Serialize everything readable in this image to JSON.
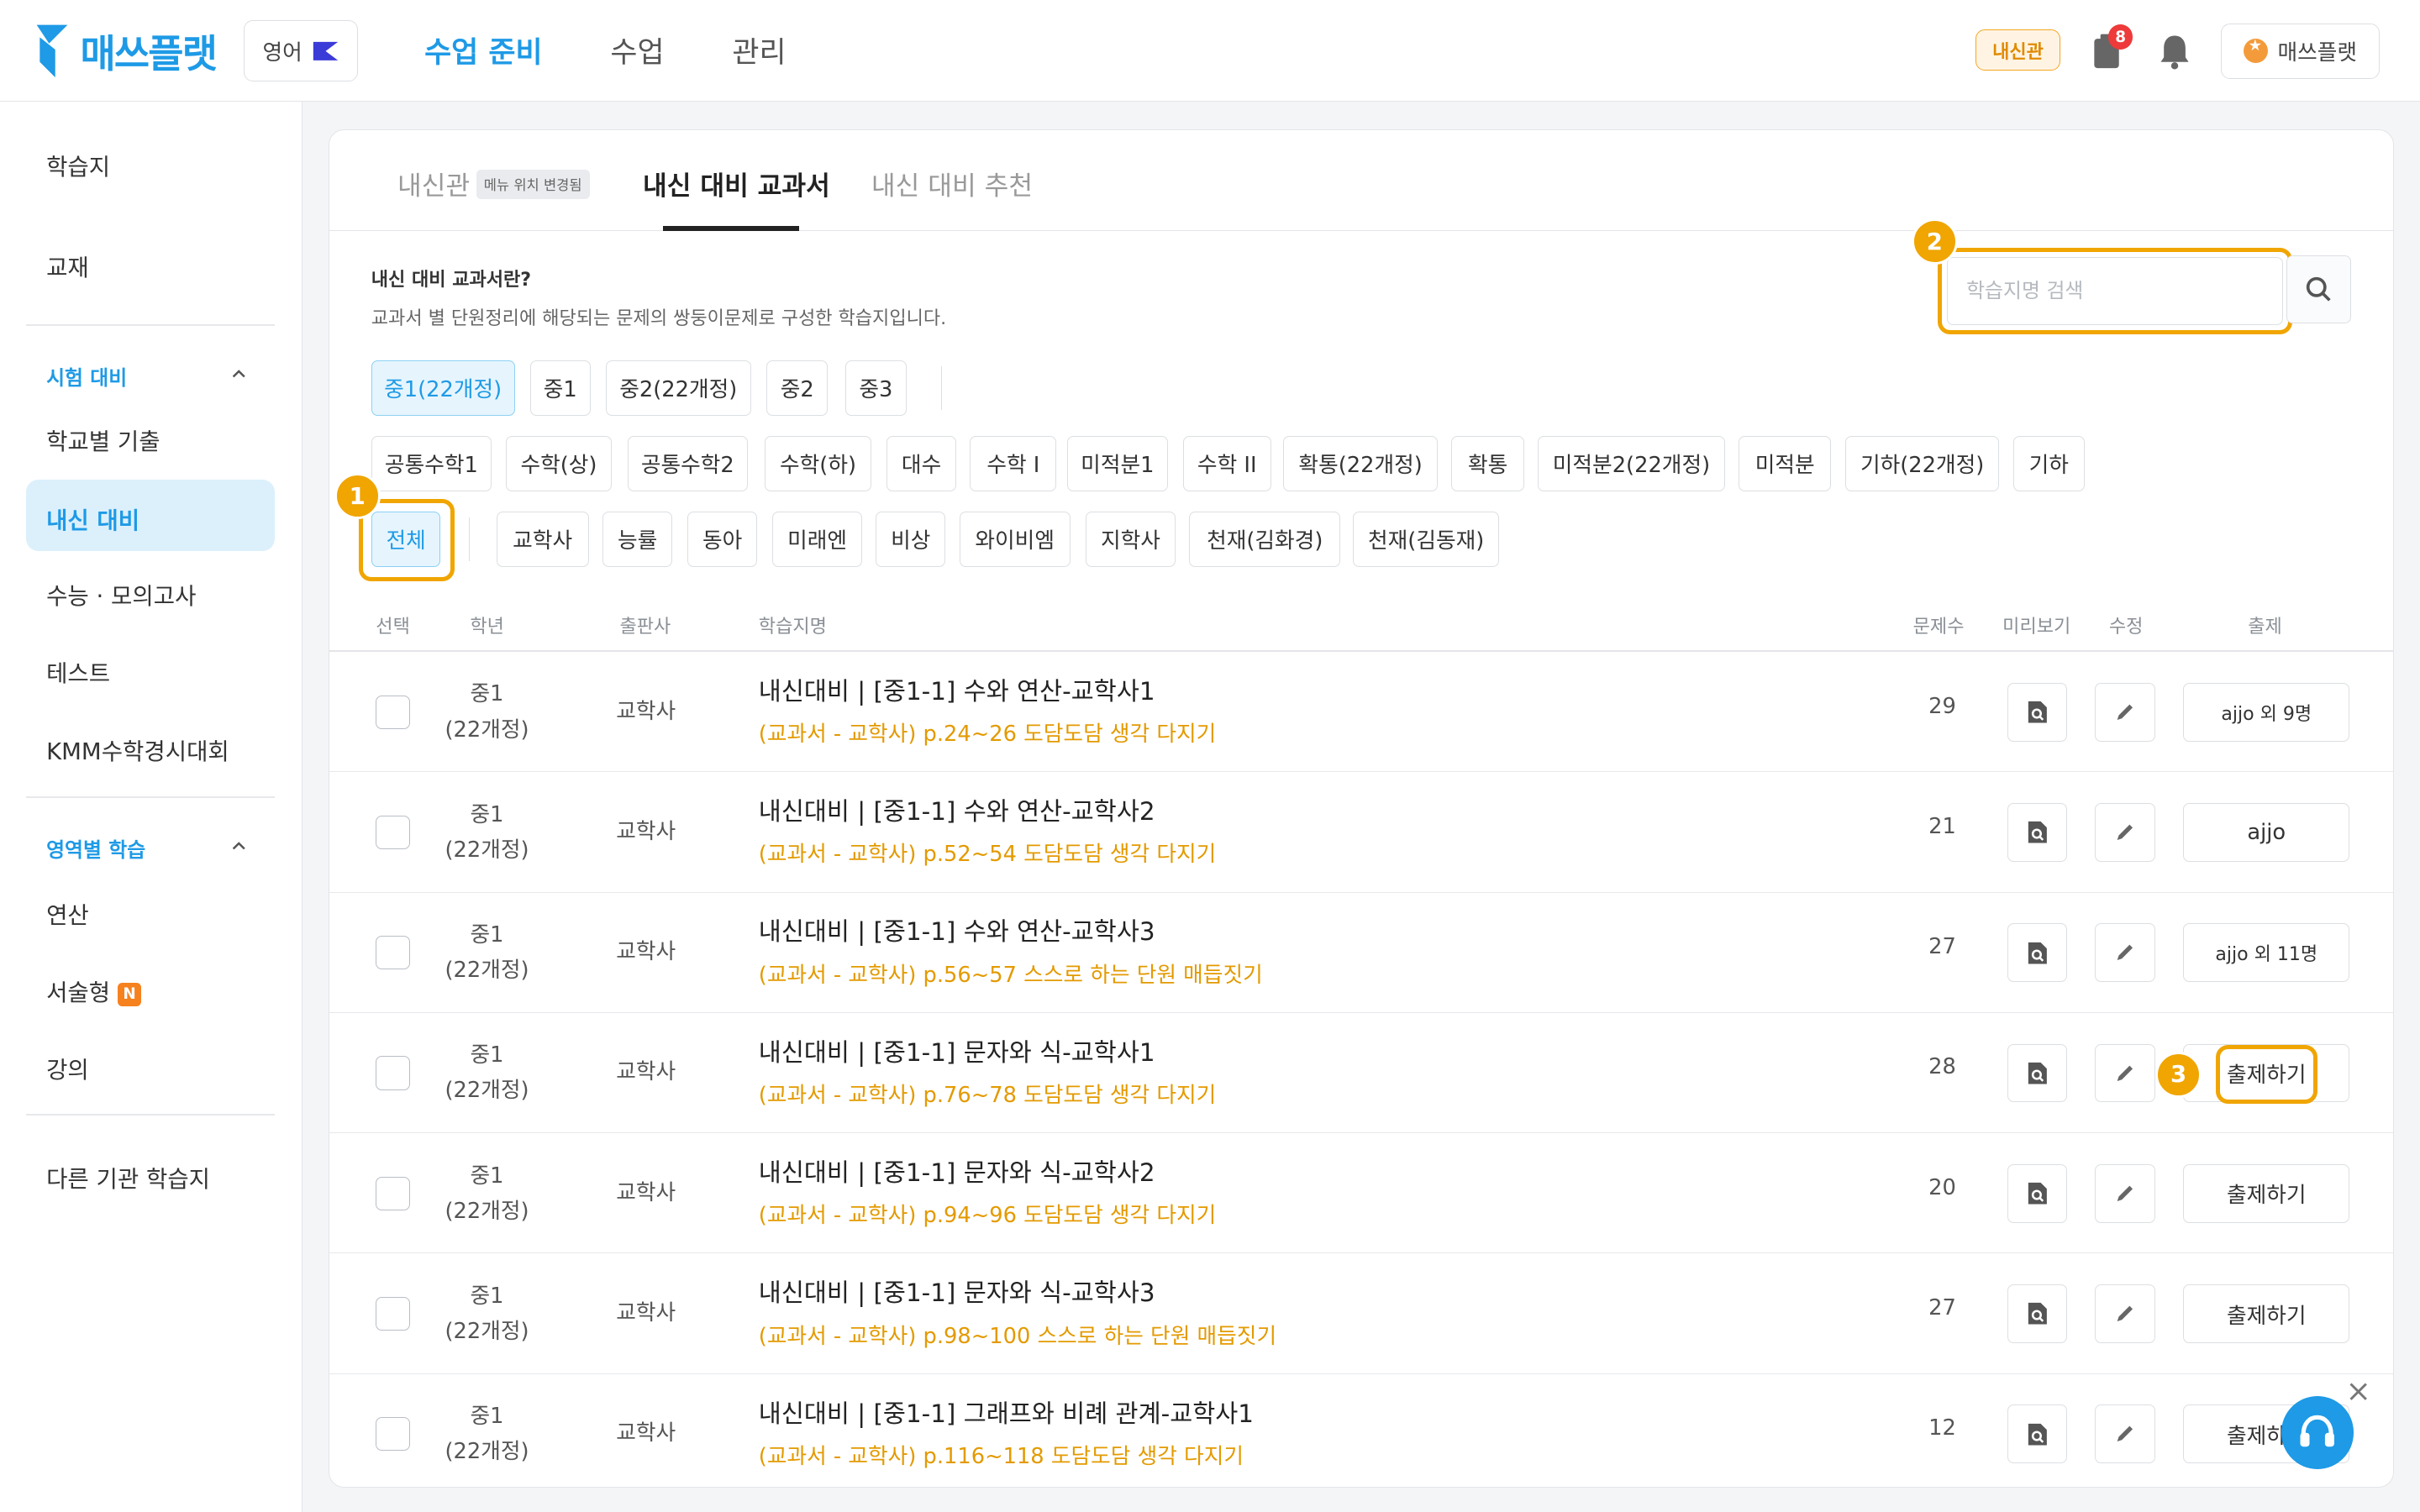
{
  "header": {
    "brand": "매쓰플랫",
    "language": "영어",
    "nav": [
      {
        "label": "수업 준비",
        "active": true
      },
      {
        "label": "수업",
        "active": false
      },
      {
        "label": "관리",
        "active": false
      }
    ],
    "naesin_badge": "내신관",
    "notification_count": "8",
    "user_label": "매쓰플랫"
  },
  "sidebar": {
    "items_top": [
      "학습지",
      "교재"
    ],
    "section_exam": "시험 대비",
    "exam_items": [
      "학교별 기출",
      "내신 대비",
      "수능 · 모의고사",
      "테스트",
      "KMM수학경시대회"
    ],
    "section_area": "영역별 학습",
    "area_items": [
      "연산",
      "서술형",
      "강의"
    ],
    "new_badge": "N",
    "other": "다른 기관 학습지"
  },
  "tabs": [
    {
      "label": "내신관",
      "badge": "메뉴 위치 변경됨",
      "active": false
    },
    {
      "label": "내신 대비 교과서",
      "active": true
    },
    {
      "label": "내신 대비 추천",
      "active": false
    }
  ],
  "description": {
    "title": "내신 대비 교과서란?",
    "text": "교과서 별 단원정리에 해당되는 문제의 쌍둥이문제로 구성한 학습지입니다."
  },
  "search": {
    "placeholder": "학습지명 검색",
    "value": ""
  },
  "callouts": [
    "1",
    "2",
    "3"
  ],
  "filters": {
    "grade": [
      "중1(22개정)",
      "중1",
      "중2(22개정)",
      "중2",
      "중3"
    ],
    "subject": [
      "공통수학1",
      "수학(상)",
      "공통수학2",
      "수학(하)",
      "대수",
      "수학 I",
      "미적분1",
      "수학 II",
      "확통(22개정)",
      "확통",
      "미적분2(22개정)",
      "미적분",
      "기하(22개정)",
      "기하"
    ],
    "publisher_all": "전체",
    "publisher": [
      "교학사",
      "능률",
      "동아",
      "미래엔",
      "비상",
      "와이비엠",
      "지학사",
      "천재(김화경)",
      "천재(김동재)"
    ]
  },
  "table": {
    "headers": [
      "선택",
      "학년",
      "출판사",
      "학습지명",
      "문제수",
      "미리보기",
      "수정",
      "출제"
    ],
    "rows": [
      {
        "grade1": "중1",
        "grade2": "(22개정)",
        "publisher": "교학사",
        "name": "내신대비 | [중1-1] 수와 연산-교학사1",
        "sub": "(교과서 - 교학사) p.24~26 도담도담 생각 다지기",
        "count": "29",
        "assign": "ajjo 외 9명"
      },
      {
        "grade1": "중1",
        "grade2": "(22개정)",
        "publisher": "교학사",
        "name": "내신대비 | [중1-1] 수와 연산-교학사2",
        "sub": "(교과서 - 교학사) p.52~54 도담도담 생각 다지기",
        "count": "21",
        "assign": "ajjo"
      },
      {
        "grade1": "중1",
        "grade2": "(22개정)",
        "publisher": "교학사",
        "name": "내신대비 | [중1-1] 수와 연산-교학사3",
        "sub": "(교과서 - 교학사) p.56~57 스스로 하는 단원 매듭짓기",
        "count": "27",
        "assign": "ajjo 외 11명"
      },
      {
        "grade1": "중1",
        "grade2": "(22개정)",
        "publisher": "교학사",
        "name": "내신대비 | [중1-1] 문자와 식-교학사1",
        "sub": "(교과서 - 교학사) p.76~78 도담도담 생각 다지기",
        "count": "28",
        "assign": "출제하기"
      },
      {
        "grade1": "중1",
        "grade2": "(22개정)",
        "publisher": "교학사",
        "name": "내신대비 | [중1-1] 문자와 식-교학사2",
        "sub": "(교과서 - 교학사) p.94~96 도담도담 생각 다지기",
        "count": "20",
        "assign": "출제하기"
      },
      {
        "grade1": "중1",
        "grade2": "(22개정)",
        "publisher": "교학사",
        "name": "내신대비 | [중1-1] 문자와 식-교학사3",
        "sub": "(교과서 - 교학사) p.98~100 스스로 하는 단원 매듭짓기",
        "count": "27",
        "assign": "출제하기"
      },
      {
        "grade1": "중1",
        "grade2": "(22개정)",
        "publisher": "교학사",
        "name": "내신대비 | [중1-1] 그래프와 비례 관계-교학사1",
        "sub": "(교과서 - 교학사) p.116~118 도담도담 생각 다지기",
        "count": "12",
        "assign": "출제하기"
      }
    ]
  },
  "colors": {
    "primary": "#1e9ae6",
    "highlight": "#f0a500",
    "sub_text": "#e39a00"
  }
}
